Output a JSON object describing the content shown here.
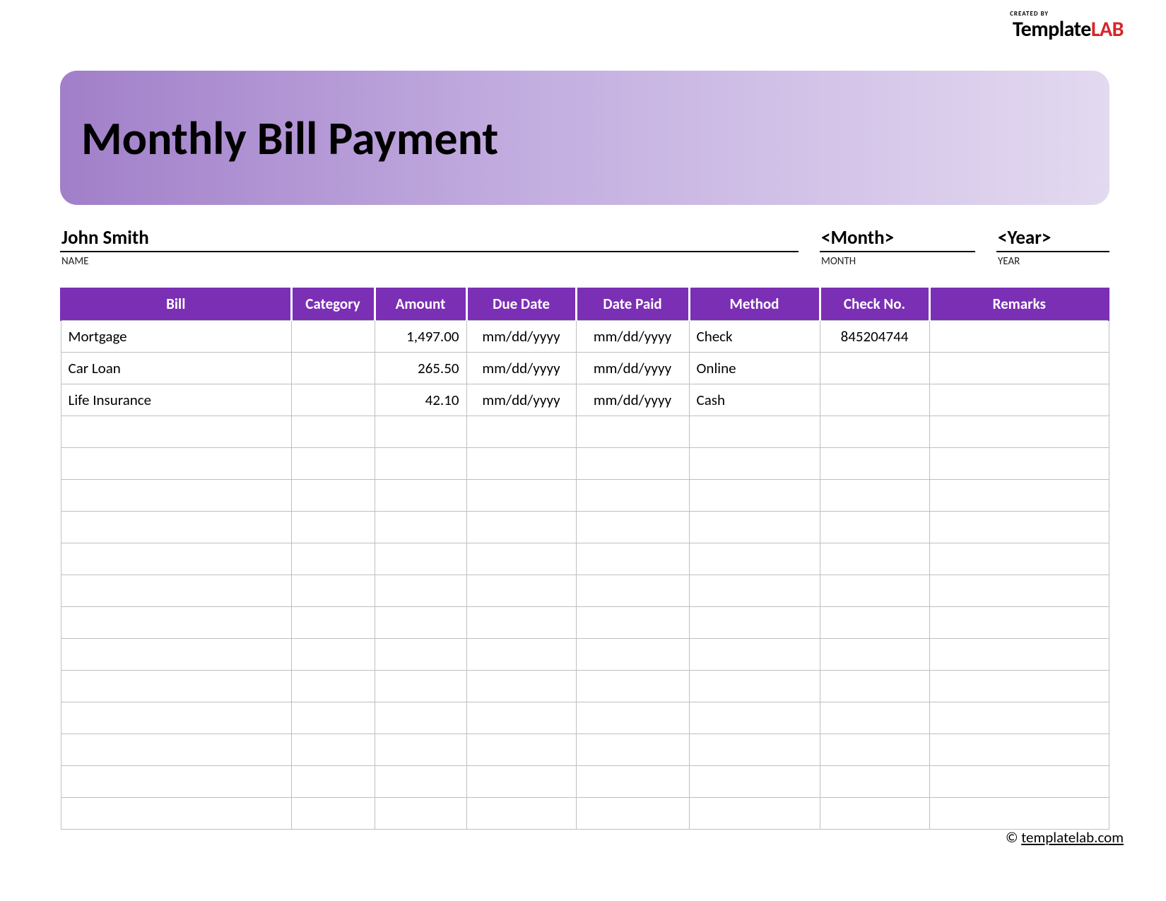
{
  "logo": {
    "created": "CREATED BY",
    "brand_a": "Template",
    "brand_b": "LAB"
  },
  "header": {
    "title": "Monthly Bill Payment"
  },
  "info": {
    "name_value": "John Smith",
    "name_label": "NAME",
    "month_value": "<Month>",
    "month_label": "MONTH",
    "year_value": "<Year>",
    "year_label": "YEAR"
  },
  "columns": {
    "bill": "Bill",
    "category": "Category",
    "amount": "Amount",
    "due_date": "Due Date",
    "date_paid": "Date Paid",
    "method": "Method",
    "check_no": "Check No.",
    "remarks": "Remarks"
  },
  "rows": [
    {
      "bill": "Mortgage",
      "category": "",
      "amount": "1,497.00",
      "due_date": "mm/dd/yyyy",
      "date_paid": "mm/dd/yyyy",
      "method": "Check",
      "check_no": "845204744",
      "remarks": ""
    },
    {
      "bill": "Car Loan",
      "category": "",
      "amount": "265.50",
      "due_date": "mm/dd/yyyy",
      "date_paid": "mm/dd/yyyy",
      "method": "Online",
      "check_no": "",
      "remarks": ""
    },
    {
      "bill": "Life Insurance",
      "category": "",
      "amount": "42.10",
      "due_date": "mm/dd/yyyy",
      "date_paid": "mm/dd/yyyy",
      "method": "Cash",
      "check_no": "",
      "remarks": ""
    },
    {
      "bill": "",
      "category": "",
      "amount": "",
      "due_date": "",
      "date_paid": "",
      "method": "",
      "check_no": "",
      "remarks": ""
    },
    {
      "bill": "",
      "category": "",
      "amount": "",
      "due_date": "",
      "date_paid": "",
      "method": "",
      "check_no": "",
      "remarks": ""
    },
    {
      "bill": "",
      "category": "",
      "amount": "",
      "due_date": "",
      "date_paid": "",
      "method": "",
      "check_no": "",
      "remarks": ""
    },
    {
      "bill": "",
      "category": "",
      "amount": "",
      "due_date": "",
      "date_paid": "",
      "method": "",
      "check_no": "",
      "remarks": ""
    },
    {
      "bill": "",
      "category": "",
      "amount": "",
      "due_date": "",
      "date_paid": "",
      "method": "",
      "check_no": "",
      "remarks": ""
    },
    {
      "bill": "",
      "category": "",
      "amount": "",
      "due_date": "",
      "date_paid": "",
      "method": "",
      "check_no": "",
      "remarks": ""
    },
    {
      "bill": "",
      "category": "",
      "amount": "",
      "due_date": "",
      "date_paid": "",
      "method": "",
      "check_no": "",
      "remarks": ""
    },
    {
      "bill": "",
      "category": "",
      "amount": "",
      "due_date": "",
      "date_paid": "",
      "method": "",
      "check_no": "",
      "remarks": ""
    },
    {
      "bill": "",
      "category": "",
      "amount": "",
      "due_date": "",
      "date_paid": "",
      "method": "",
      "check_no": "",
      "remarks": ""
    },
    {
      "bill": "",
      "category": "",
      "amount": "",
      "due_date": "",
      "date_paid": "",
      "method": "",
      "check_no": "",
      "remarks": ""
    },
    {
      "bill": "",
      "category": "",
      "amount": "",
      "due_date": "",
      "date_paid": "",
      "method": "",
      "check_no": "",
      "remarks": ""
    },
    {
      "bill": "",
      "category": "",
      "amount": "",
      "due_date": "",
      "date_paid": "",
      "method": "",
      "check_no": "",
      "remarks": ""
    },
    {
      "bill": "",
      "category": "",
      "amount": "",
      "due_date": "",
      "date_paid": "",
      "method": "",
      "check_no": "",
      "remarks": ""
    }
  ],
  "footer": {
    "copyright": "©",
    "link_text": "templatelab.com"
  }
}
